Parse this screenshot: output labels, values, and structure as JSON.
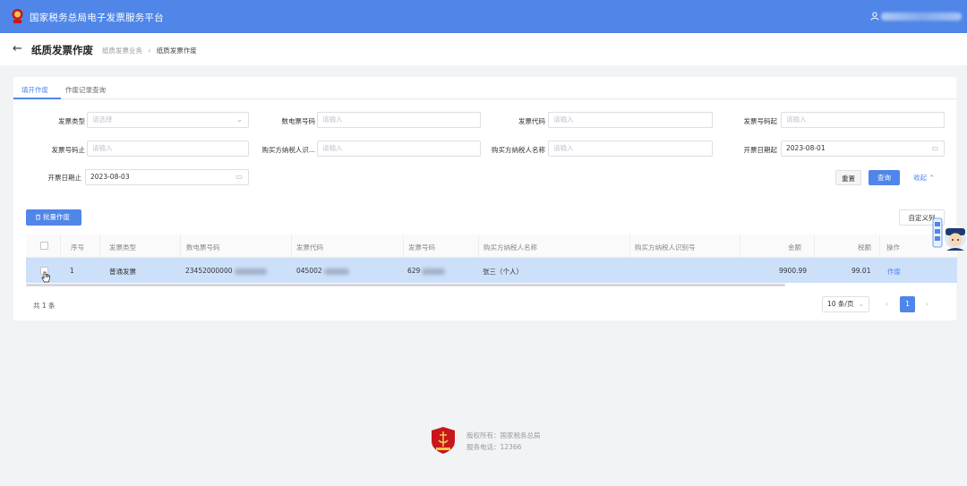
{
  "header": {
    "app_title": "国家税务总局电子发票服务平台",
    "logo_icon": "tax-emblem-icon",
    "user_icon": "user-icon"
  },
  "page": {
    "back_icon": "←",
    "title": "纸质发票作废",
    "breadcrumb": [
      "纸质发票业务",
      "纸质发票作废"
    ],
    "breadcrumb_sep": "›"
  },
  "tabs": [
    {
      "label": "填开作废",
      "active": true
    },
    {
      "label": "作废记录查询",
      "active": false
    }
  ],
  "filters": {
    "invoice_type": {
      "label": "发票类型",
      "placeholder": "请选择"
    },
    "digital_invoice_no": {
      "label": "数电票号码",
      "placeholder": "请输入"
    },
    "invoice_code": {
      "label": "发票代码",
      "placeholder": "请输入"
    },
    "invoice_no_start": {
      "label": "发票号码起",
      "placeholder": "请输入"
    },
    "invoice_no_end": {
      "label": "发票号码止",
      "placeholder": "请输入"
    },
    "buyer_tax_id": {
      "label": "购买方纳税人识...",
      "placeholder": "请输入"
    },
    "buyer_name": {
      "label": "购买方纳税人名称",
      "placeholder": "请输入"
    },
    "issue_date_start": {
      "label": "开票日期起",
      "value": "2023-08-01"
    },
    "issue_date_end": {
      "label": "开票日期止",
      "value": "2023-08-03"
    }
  },
  "actions": {
    "reset": "重置",
    "query": "查询",
    "collapse": "收起 ⌃",
    "batch_void": "批量作废",
    "custom_columns": "自定义列"
  },
  "table": {
    "columns": [
      "序号",
      "发票类型",
      "数电票号码",
      "发票代码",
      "发票号码",
      "购买方纳税人名称",
      "购买方纳税人识别号",
      "金额",
      "税额",
      "操作"
    ],
    "rows": [
      {
        "index": "1",
        "invoice_type": "普通发票",
        "digital_invoice_no": "23452000000",
        "invoice_code": "045002",
        "invoice_no": "629",
        "buyer_name": "张三（个人）",
        "buyer_tax_id": "",
        "amount": "9900.99",
        "tax": "99.01",
        "action": "作废"
      }
    ]
  },
  "pagination": {
    "total": "共 1 条",
    "page_size": "10 条/页",
    "prev": "‹",
    "current": "1",
    "next": "›"
  },
  "footer": {
    "copyright": "版权所有：国家税务总局",
    "hotline": "服务电话：12366"
  },
  "colors": {
    "primary": "#4f86e8",
    "selected_row": "#cde0fa",
    "emblem": "#c8161d"
  }
}
